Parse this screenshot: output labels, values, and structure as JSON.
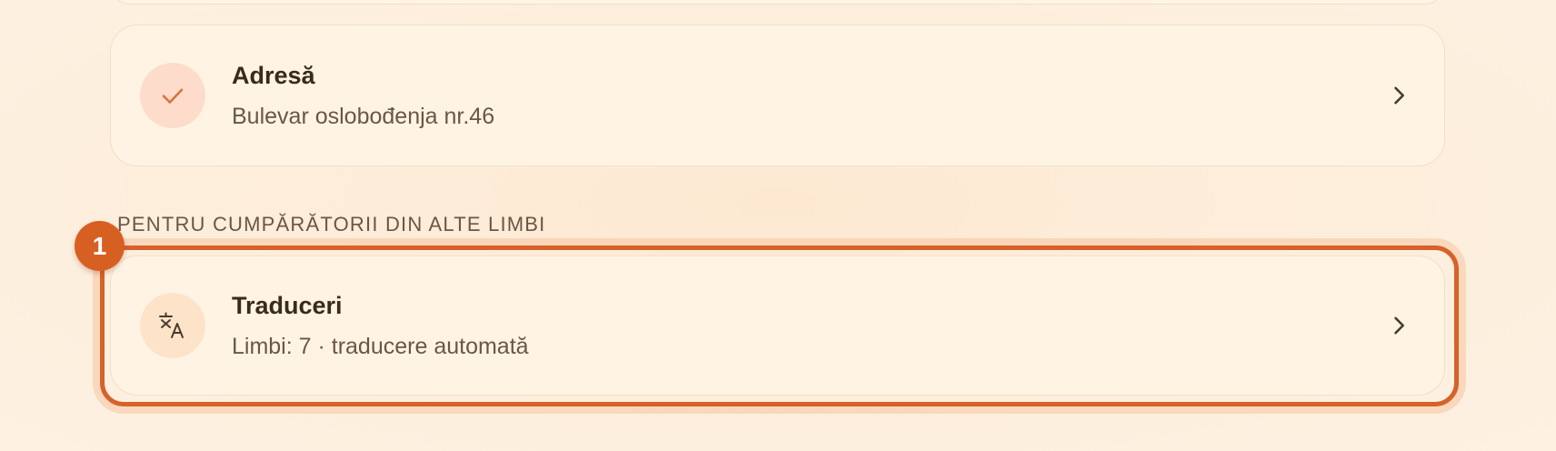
{
  "address_card": {
    "icon": "check-icon",
    "title": "Adresă",
    "subtitle": "Bulevar oslobođenja nr.46"
  },
  "section": {
    "label": "PENTRU CUMPĂRĂTORII DIN ALTE LIMBI"
  },
  "translations_card": {
    "icon": "translate-icon",
    "title": "Traduceri",
    "subtitle": "Limbi: 7 · traducere automată"
  },
  "annotation": {
    "step_number": "1"
  },
  "colors": {
    "accent": "#d85f22",
    "background": "#fdeedb",
    "card": "#fff4e4"
  }
}
